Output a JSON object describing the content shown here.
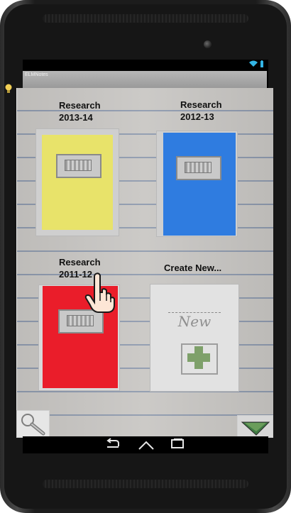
{
  "window": {
    "title": "ELMNotes"
  },
  "notebooks": [
    {
      "label": "Research\n2013-14",
      "color": "#e8e36a"
    },
    {
      "label": "Research\n2012-13",
      "color": "#2f7ce0"
    },
    {
      "label": "Research\n2011-12",
      "color": "#ea1d2a"
    }
  ],
  "create_new": {
    "label": "Create New...",
    "sketch_text": "New"
  },
  "toolbar": {
    "search_icon": "magnifier-icon",
    "create_icon": "green-triangle-icon"
  },
  "nav": {
    "back_icon": "back-icon",
    "home_icon": "home-icon",
    "recents_icon": "recents-icon"
  },
  "status": {
    "icons": [
      "wifi-icon",
      "battery-icon"
    ]
  }
}
